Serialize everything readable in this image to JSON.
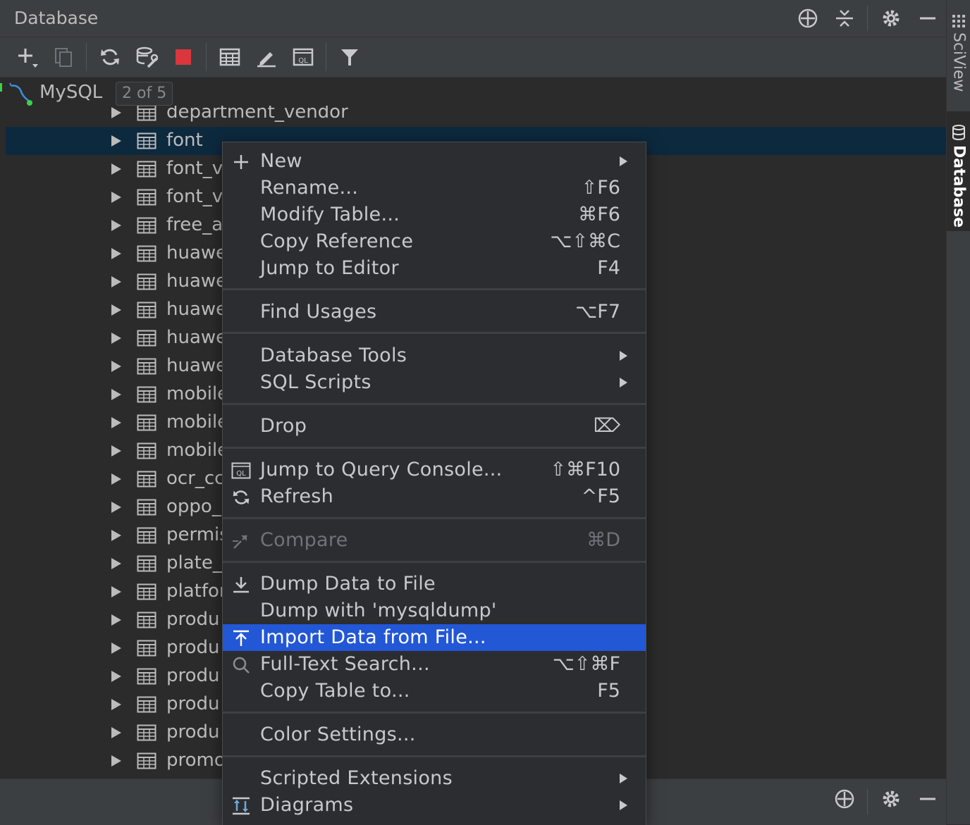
{
  "panel": {
    "title": "Database"
  },
  "tree": {
    "datasource": {
      "name": "MySQL",
      "badge": "2 of 5"
    },
    "rows": [
      "department_vendor",
      "font",
      "font_v",
      "font_v",
      "free_a",
      "huawe",
      "huawe",
      "huawe",
      "huawe",
      "huawe",
      "mobile",
      "mobile",
      "mobile",
      "ocr_cc",
      "oppo_",
      "permis",
      "plate_",
      "platfor",
      "produ",
      "produ",
      "produ",
      "produ",
      "produ",
      "promo"
    ],
    "selected_row": "font"
  },
  "side_tabs": {
    "sciview": "SciView",
    "database": "Database"
  },
  "menu": {
    "items": [
      {
        "label": "New",
        "key": "",
        "submenu": true,
        "icon": "plus-icon"
      },
      {
        "label": "Rename...",
        "key": "⇧F6"
      },
      {
        "label": "Modify Table...",
        "key": "⌘F6"
      },
      {
        "label": "Copy Reference",
        "key": "⌥⇧⌘C"
      },
      {
        "label": "Jump to Editor",
        "key": "F4"
      },
      {
        "label": "Find Usages",
        "key": "⌥F7"
      },
      {
        "label": "Database Tools",
        "key": "",
        "submenu": true
      },
      {
        "label": "SQL Scripts",
        "key": "",
        "submenu": true
      },
      {
        "label": "Drop",
        "key": "⌦"
      },
      {
        "label": "Jump to Query Console...",
        "key": "⇧⌘F10",
        "icon": "query-console-icon"
      },
      {
        "label": "Refresh",
        "key": "^F5",
        "icon": "refresh-icon"
      },
      {
        "label": "Compare",
        "key": "⌘D",
        "disabled": true,
        "icon": "compare-icon"
      },
      {
        "label": "Dump Data to File",
        "key": "",
        "icon": "download-icon"
      },
      {
        "label": "Dump with 'mysqldump'",
        "key": ""
      },
      {
        "label": "Import Data from File...",
        "key": "",
        "highlighted": true,
        "icon": "upload-icon"
      },
      {
        "label": "Full-Text Search...",
        "key": "⌥⇧⌘F",
        "icon": "search-icon"
      },
      {
        "label": "Copy Table to...",
        "key": "F5"
      },
      {
        "label": "Color Settings...",
        "key": ""
      },
      {
        "label": "Scripted Extensions",
        "key": "",
        "submenu": true
      },
      {
        "label": "Diagrams",
        "key": "",
        "submenu": true,
        "icon": "diagram-icon"
      }
    ]
  },
  "colors": {
    "selection": "#2257d6",
    "row_selected": "#0d293e",
    "stop_red": "#d9363e"
  }
}
